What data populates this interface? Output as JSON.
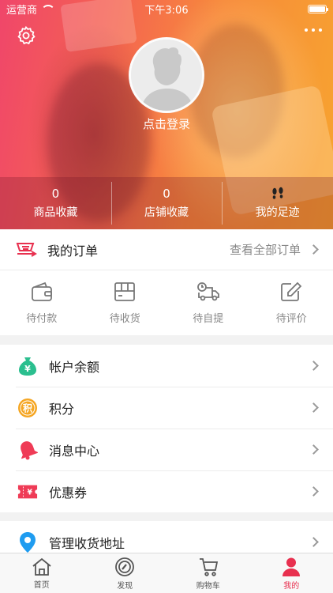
{
  "status_bar": {
    "carrier": "运营商",
    "time": "下午3:06"
  },
  "header": {
    "login_label": "点击登录",
    "stats": [
      {
        "value": "0",
        "label": "商品收藏"
      },
      {
        "value": "0",
        "label": "店铺收藏"
      },
      {
        "icon": "footprint-icon",
        "label": "我的足迹"
      }
    ]
  },
  "orders": {
    "title": "我的订单",
    "view_all": "查看全部订单",
    "tabs": [
      {
        "icon": "wallet-icon",
        "label": "待付款"
      },
      {
        "icon": "box-icon",
        "label": "待收货"
      },
      {
        "icon": "truck-icon",
        "label": "待自提"
      },
      {
        "icon": "edit-icon",
        "label": "待评价"
      }
    ]
  },
  "menu": [
    {
      "icon": "money-bag-icon",
      "label": "帐户余额",
      "color": "#2bbf8f"
    },
    {
      "icon": "points-icon",
      "label": "积分",
      "color": "#f5a623"
    },
    {
      "icon": "bell-icon",
      "label": "消息中心",
      "color": "#ef3b56"
    },
    {
      "icon": "coupon-icon",
      "label": "优惠券",
      "color": "#ef3b56"
    }
  ],
  "menu2": [
    {
      "icon": "location-icon",
      "label": "管理收货地址",
      "color": "#1f9cf0"
    }
  ],
  "tabbar": {
    "active_color": "#e8304f",
    "tabs": [
      {
        "icon": "home-icon",
        "label": "首页"
      },
      {
        "icon": "compass-icon",
        "label": "发现"
      },
      {
        "icon": "cart-icon",
        "label": "购物车"
      },
      {
        "icon": "user-icon",
        "label": "我的",
        "active": true
      }
    ]
  }
}
